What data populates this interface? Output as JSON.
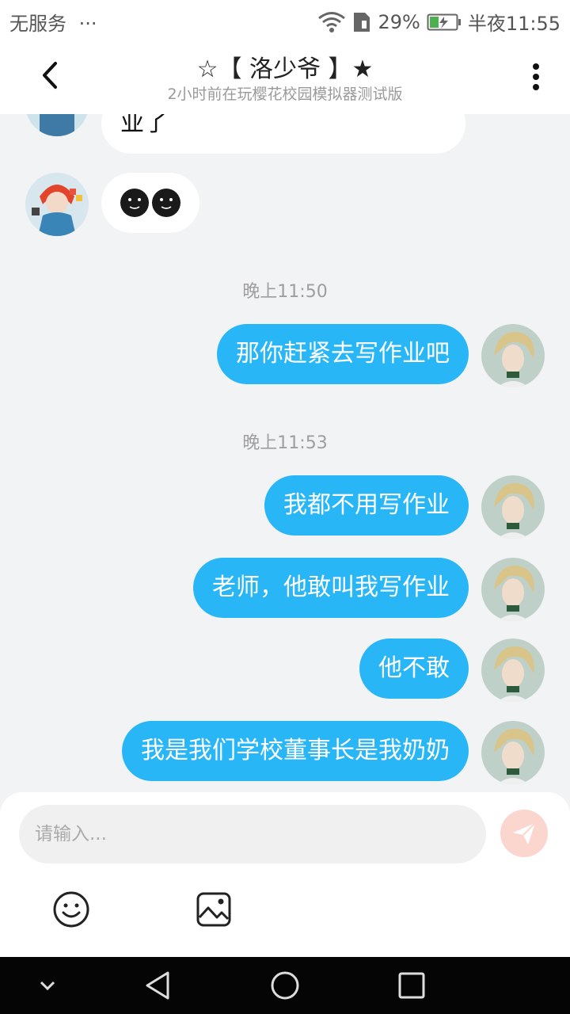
{
  "status": {
    "carrier": "无服务",
    "dots": "···",
    "battery_pct": "29%",
    "time": "半夜11:55"
  },
  "header": {
    "title": "☆【 洛少爷 】★",
    "subtitle": "2小时前在玩樱花校园模拟器测试版"
  },
  "messages": {
    "in_partial": "业了",
    "in_emoji": "●●",
    "ts1": "晚上11:50",
    "out1": "那你赶紧去写作业吧",
    "ts2": "晚上11:53",
    "out2": "我都不用写作业",
    "out3": "老师，他敢叫我写作业",
    "out4": "他不敢",
    "out5": "我是我们学校董事长是我奶奶"
  },
  "composer": {
    "placeholder": "请输入..."
  },
  "colors": {
    "bubble_out": "#29b6f6",
    "send_disabled": "#fbd6cf"
  }
}
